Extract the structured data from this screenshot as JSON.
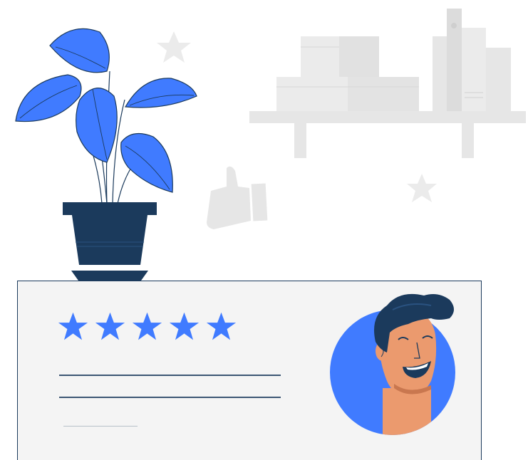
{
  "scene": {
    "accent_color": "#407bff",
    "dark_color": "#1b3a5c",
    "skin_color": "#eb9a6e",
    "decor_gray": "#e6e6e6",
    "icons": [
      "plant-icon",
      "shelf-icon",
      "thumbs-up-icon",
      "star-icon",
      "avatar-icon"
    ]
  },
  "review": {
    "rating": 5,
    "max_rating": 5
  }
}
